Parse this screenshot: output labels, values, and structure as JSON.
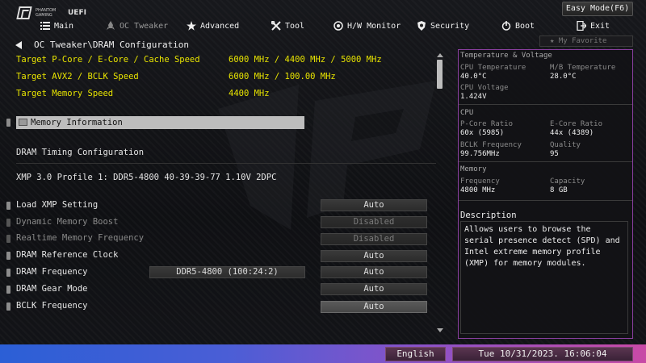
{
  "brand": {
    "logo_text": "PHANTOM GAMING",
    "uefi_label": "UEFI"
  },
  "easy_mode_label": "Easy Mode(F6)",
  "nav": [
    {
      "label": "Main",
      "icon": "list-icon",
      "active": false
    },
    {
      "label": "OC Tweaker",
      "icon": "rocket-icon",
      "active": true
    },
    {
      "label": "Advanced",
      "icon": "star-icon",
      "active": false
    },
    {
      "label": "Tool",
      "icon": "wrench-icon",
      "active": false
    },
    {
      "label": "H/W Monitor",
      "icon": "monitor-icon",
      "active": false
    },
    {
      "label": "Security",
      "icon": "shield-icon",
      "active": false
    },
    {
      "label": "Boot",
      "icon": "power-icon",
      "active": false
    },
    {
      "label": "Exit",
      "icon": "exit-icon",
      "active": false
    }
  ],
  "breadcrumb": "OC Tweaker\\DRAM Configuration",
  "targets": [
    {
      "label": "Target P-Core / E-Core / Cache Speed",
      "value": "6000 MHz / 4400 MHz / 5000 MHz"
    },
    {
      "label": "Target AVX2 / BCLK Speed",
      "value": "6000 MHz / 100.00 MHz"
    },
    {
      "label": "Target Memory Speed",
      "value": "4400 MHz"
    }
  ],
  "memory_information": "Memory Information",
  "dram_timing_configuration": "DRAM Timing Configuration",
  "xmp_profile": "XMP 3.0 Profile 1: DDR5-4800 40-39-39-77 1.10V 2DPC",
  "settings": [
    {
      "label": "Load XMP Setting",
      "value": "Auto",
      "disabled": false
    },
    {
      "label": "Dynamic Memory Boost",
      "value": "Disabled",
      "disabled": true
    },
    {
      "label": "Realtime Memory Frequency",
      "value": "Disabled",
      "disabled": true
    },
    {
      "label": "DRAM Reference Clock",
      "value": "Auto",
      "disabled": false
    },
    {
      "label": "DRAM Frequency",
      "value": "Auto",
      "disabled": false,
      "extra": "DDR5-4800 (100:24:2)"
    },
    {
      "label": "DRAM Gear Mode",
      "value": "Auto",
      "disabled": false
    },
    {
      "label": "BCLK Frequency",
      "value": "Auto",
      "disabled": false,
      "selected": true
    }
  ],
  "favorite_label": "My Favorite",
  "panel": {
    "temp_voltage_title": "Temperature & Voltage",
    "cpu_temp_label": "CPU Temperature",
    "cpu_temp_value": "40.0°C",
    "mb_temp_label": "M/B Temperature",
    "mb_temp_value": "28.0°C",
    "cpu_voltage_label": "CPU Voltage",
    "cpu_voltage_value": "1.424V",
    "cpu_title": "CPU",
    "pcore_label": "P-Core Ratio",
    "pcore_value": "60x (5985)",
    "ecore_label": "E-Core Ratio",
    "ecore_value": "44x (4389)",
    "bclk_label": "BCLK Frequency",
    "bclk_value": "99.756MHz",
    "quality_label": "Quality",
    "quality_value": "95",
    "memory_title": "Memory",
    "mem_freq_label": "Frequency",
    "mem_freq_value": "4800 MHz",
    "capacity_label": "Capacity",
    "capacity_value": "8 GB",
    "description_title": "Description",
    "description_text": "Allows users to browse the serial presence detect (SPD) and Intel extreme memory profile (XMP) for memory modules."
  },
  "footer": {
    "language": "English",
    "datetime": "Tue 10/31/2023. 16:06:04"
  },
  "colors": {
    "accent_yellow": "#e8e400",
    "panel_border": "#8a3fa0",
    "bottom_bar_start": "#2b5fd6",
    "bottom_bar_end": "#c84aa6"
  }
}
